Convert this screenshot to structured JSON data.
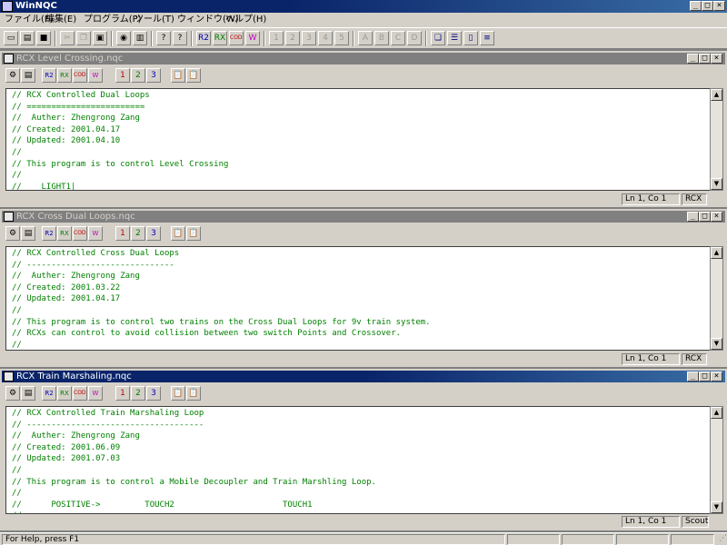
{
  "app": {
    "title": "WinNQC"
  },
  "menu": [
    "ファイル(F)",
    "編集(E)",
    "プログラム(P)",
    "ツール(T)",
    "ウィンドウ(W)",
    "ヘルプ(H)"
  ],
  "toolbar": {
    "file": [
      "new",
      "open",
      "save"
    ],
    "edit": [
      "cut",
      "copy",
      "paste"
    ],
    "find_print": [
      "find",
      "print"
    ],
    "help": [
      "help",
      "context-help"
    ],
    "rcx": [
      "R2",
      "RX",
      "CODE",
      "W"
    ],
    "program": [
      "1",
      "2",
      "3",
      "4",
      "5"
    ],
    "run": [
      "A",
      "B",
      "C",
      "D"
    ],
    "window": [
      "cascade",
      "tile-h",
      "tile-v",
      "arrange"
    ]
  },
  "windows": [
    {
      "title": "RCX Level Crossing.nqc",
      "active": false,
      "code": [
        "// RCX Controlled Dual Loops",
        "// ========================",
        "//  Auther: Zhengrong Zang",
        "// Created: 2001.04.17",
        "// Updated: 2001.04.10",
        "//",
        "// This program is to control Level Crossing",
        "//",
        "//    LIGHT1|"
      ],
      "status": {
        "position": "Ln 1, Co 1",
        "target": "RCX"
      }
    },
    {
      "title": "RCX Cross Dual Loops.nqc",
      "active": false,
      "code": [
        "// RCX Controlled Cross Dual Loops",
        "// ------------------------------",
        "//  Auther: Zhengrong Zang",
        "// Created: 2001.03.22",
        "// Updated: 2001.04.17",
        "//",
        "// This program is to control two trains on the Cross Dual Loops for 9v train system.",
        "// RCXs can control to avoid collision between two switch Points and Crossover.",
        "//"
      ],
      "status": {
        "position": "Ln 1, Co 1",
        "target": "RCX"
      }
    },
    {
      "title": "RCX Train Marshaling.nqc",
      "active": true,
      "code": [
        "// RCX Controlled Train Marshaling Loop",
        "// ------------------------------------",
        "//  Auther: Zhengrong Zang",
        "// Created: 2001.06.09",
        "// Updated: 2001.07.03",
        "//",
        "// This program is to control a Mobile Decoupler and Train Marshling Loop.",
        "//",
        "//      POSITIVE->         TOUCH2                      TOUCH1",
        "//"
      ],
      "status": {
        "position": "Ln 1, Co 1",
        "target": "Scout"
      }
    }
  ],
  "statusbar": {
    "help_text": "For Help, press F1"
  }
}
